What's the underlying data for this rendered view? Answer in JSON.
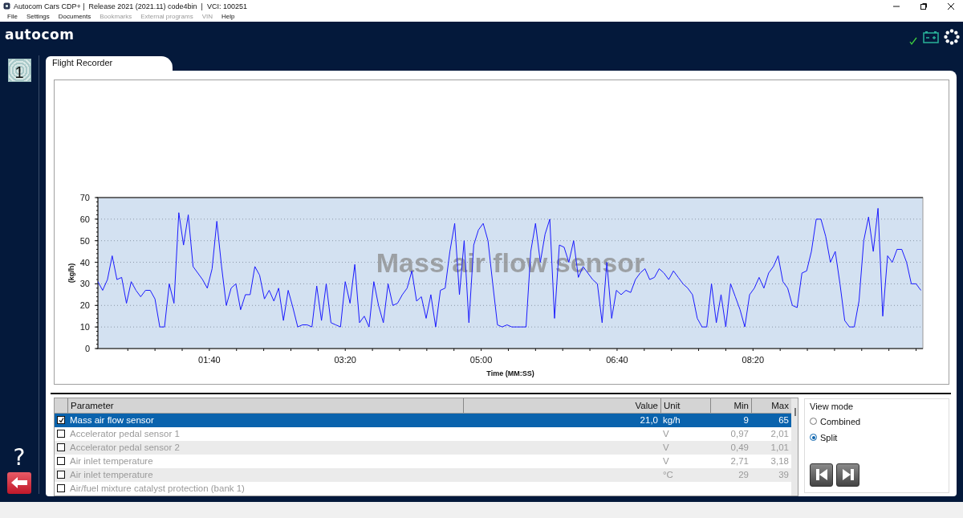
{
  "window": {
    "title": "Autocom Cars CDP+ |  Release 2021 (2021.11) code4bin  |  VCI: 100251"
  },
  "menu": [
    {
      "label": "File",
      "disabled": false
    },
    {
      "label": "Settings",
      "disabled": false
    },
    {
      "label": "Documents",
      "disabled": false
    },
    {
      "label": "Bookmarks",
      "disabled": true
    },
    {
      "label": "External programs",
      "disabled": true
    },
    {
      "label": "VIN",
      "disabled": true
    },
    {
      "label": "Help",
      "disabled": false
    }
  ],
  "logo": "autocom",
  "sidebar": {
    "badge": "1",
    "help": "?"
  },
  "tab": {
    "label": "Flight Recorder",
    "selected": true
  },
  "chart": {
    "chart_data": {
      "type": "line",
      "grid": true,
      "title": "Mass air flow sensor",
      "xlabel": "Time (MM:SS)",
      "ylabel": "(kg/h)",
      "xlim": [
        18,
        625
      ],
      "ylim": [
        0,
        70
      ],
      "yticks": [
        0,
        10,
        20,
        30,
        40,
        50,
        60,
        70
      ],
      "xticks": [
        {
          "value": 100,
          "label": "01:40"
        },
        {
          "value": 200,
          "label": "03:20"
        },
        {
          "value": 300,
          "label": "05:00"
        },
        {
          "value": 400,
          "label": "06:40"
        },
        {
          "value": 500,
          "label": "08:20"
        }
      ],
      "x": [
        18,
        21.5,
        25,
        28.5,
        32,
        35.5,
        39,
        42.5,
        46,
        49.5,
        53,
        56.5,
        60,
        63.5,
        67,
        70.5,
        74,
        77.5,
        81,
        84.5,
        88,
        91.5,
        95,
        98.5,
        102,
        105.5,
        109,
        112.5,
        116,
        119.5,
        123,
        126.5,
        130,
        133.5,
        137,
        140.5,
        144,
        147.5,
        151,
        154.5,
        158,
        161.5,
        165,
        168.5,
        172,
        175.5,
        179,
        182.5,
        186,
        189.5,
        193,
        196.5,
        200,
        203.5,
        207,
        210.5,
        214,
        217.5,
        221,
        224.5,
        228,
        231.5,
        235,
        238.5,
        242,
        245.5,
        249,
        252.5,
        256,
        259.5,
        263,
        266.5,
        270,
        273.5,
        277,
        280.5,
        284,
        287.5,
        291,
        294.5,
        298,
        301.5,
        305,
        308.5,
        312,
        315.5,
        319,
        322.5,
        326,
        329.5,
        333,
        336.5,
        340,
        343.5,
        347,
        350.5,
        354,
        357.5,
        361,
        364.5,
        368,
        371.5,
        375,
        378.5,
        382,
        385.5,
        389,
        392.5,
        396,
        399.5,
        403,
        406.5,
        410,
        413.5,
        417,
        420.5,
        424,
        427.5,
        431,
        434.5,
        438,
        441.5,
        445,
        448.5,
        452,
        455.5,
        459,
        462.5,
        466,
        469.5,
        473,
        476.5,
        480,
        483.5,
        487,
        490.5,
        494,
        497.5,
        501,
        504.5,
        508,
        511.5,
        515,
        518.5,
        522,
        525.5,
        529,
        532.5,
        536,
        539.5,
        543,
        546.5,
        550,
        553.5,
        557,
        560.5,
        564,
        567.5,
        571,
        574.5,
        578,
        581.5,
        585,
        588.5,
        592,
        595.5,
        599,
        602.5,
        606,
        609.5,
        613,
        616.5,
        620,
        623.5
      ],
      "series": [
        {
          "color": "#1a1aff",
          "values": [
            31,
            27,
            32,
            43,
            32,
            33,
            21,
            31,
            27,
            24,
            27,
            27,
            23,
            10,
            10,
            30,
            21,
            63,
            48,
            62,
            38,
            35,
            32,
            28,
            37,
            59,
            38,
            20,
            28,
            30,
            18,
            25,
            25,
            38,
            34,
            23,
            27,
            22,
            28,
            13,
            27,
            19,
            10,
            11,
            11,
            10,
            29,
            13,
            30,
            12,
            11,
            10,
            31,
            21,
            39,
            12,
            15,
            10,
            31,
            20,
            12,
            30,
            20,
            21,
            25,
            28,
            36,
            22,
            24,
            14,
            25,
            10,
            27,
            28,
            45,
            58,
            25,
            50,
            12,
            48,
            55,
            58,
            50,
            30,
            11,
            10,
            11,
            10,
            10,
            10,
            10,
            45,
            58,
            40,
            53,
            60,
            14,
            48,
            47,
            40,
            50,
            33,
            38,
            35,
            32,
            30,
            12,
            40,
            14,
            27,
            25,
            27,
            26,
            32,
            35,
            37,
            32,
            33,
            37,
            35,
            32,
            36,
            33,
            30,
            28,
            25,
            14,
            10,
            10,
            30,
            12,
            25,
            10,
            30,
            24,
            18,
            10,
            25,
            28,
            33,
            28,
            35,
            38,
            43,
            31,
            28,
            20,
            19,
            35,
            36,
            45,
            60,
            60,
            52,
            40,
            45,
            30,
            13,
            10,
            10,
            22,
            50,
            61,
            45,
            65,
            15,
            43,
            40,
            46,
            46,
            40,
            30,
            30,
            27
          ]
        }
      ]
    }
  },
  "table": {
    "columns": [
      "Parameter",
      "Value",
      "Unit",
      "Min",
      "Max"
    ],
    "rows": [
      {
        "parameter": "Mass air flow sensor",
        "value": "21,0",
        "unit": "kg/h",
        "min": "9",
        "max": "65",
        "checked": true,
        "selected": true
      },
      {
        "parameter": "Accelerator pedal sensor 1",
        "unit": "V",
        "min": "0,97",
        "max": "2,01",
        "checked": false,
        "selected": false
      },
      {
        "parameter": "Accelerator pedal sensor 2",
        "unit": "V",
        "min": "0,49",
        "max": "1,01",
        "checked": false,
        "selected": false
      },
      {
        "parameter": "Air inlet temperature",
        "unit": "V",
        "min": "2,71",
        "max": "3,18",
        "checked": false,
        "selected": false
      },
      {
        "parameter": "Air inlet temperature",
        "unit": "°C",
        "min": "29",
        "max": "39",
        "checked": false,
        "selected": false
      },
      {
        "parameter": "Air/fuel mixture catalyst protection (bank 1)",
        "checked": false,
        "selected": false
      }
    ]
  },
  "view_mode": {
    "title": "View mode",
    "options": [
      {
        "label": "Combined",
        "selected": false
      },
      {
        "label": "Split",
        "selected": true
      }
    ]
  }
}
